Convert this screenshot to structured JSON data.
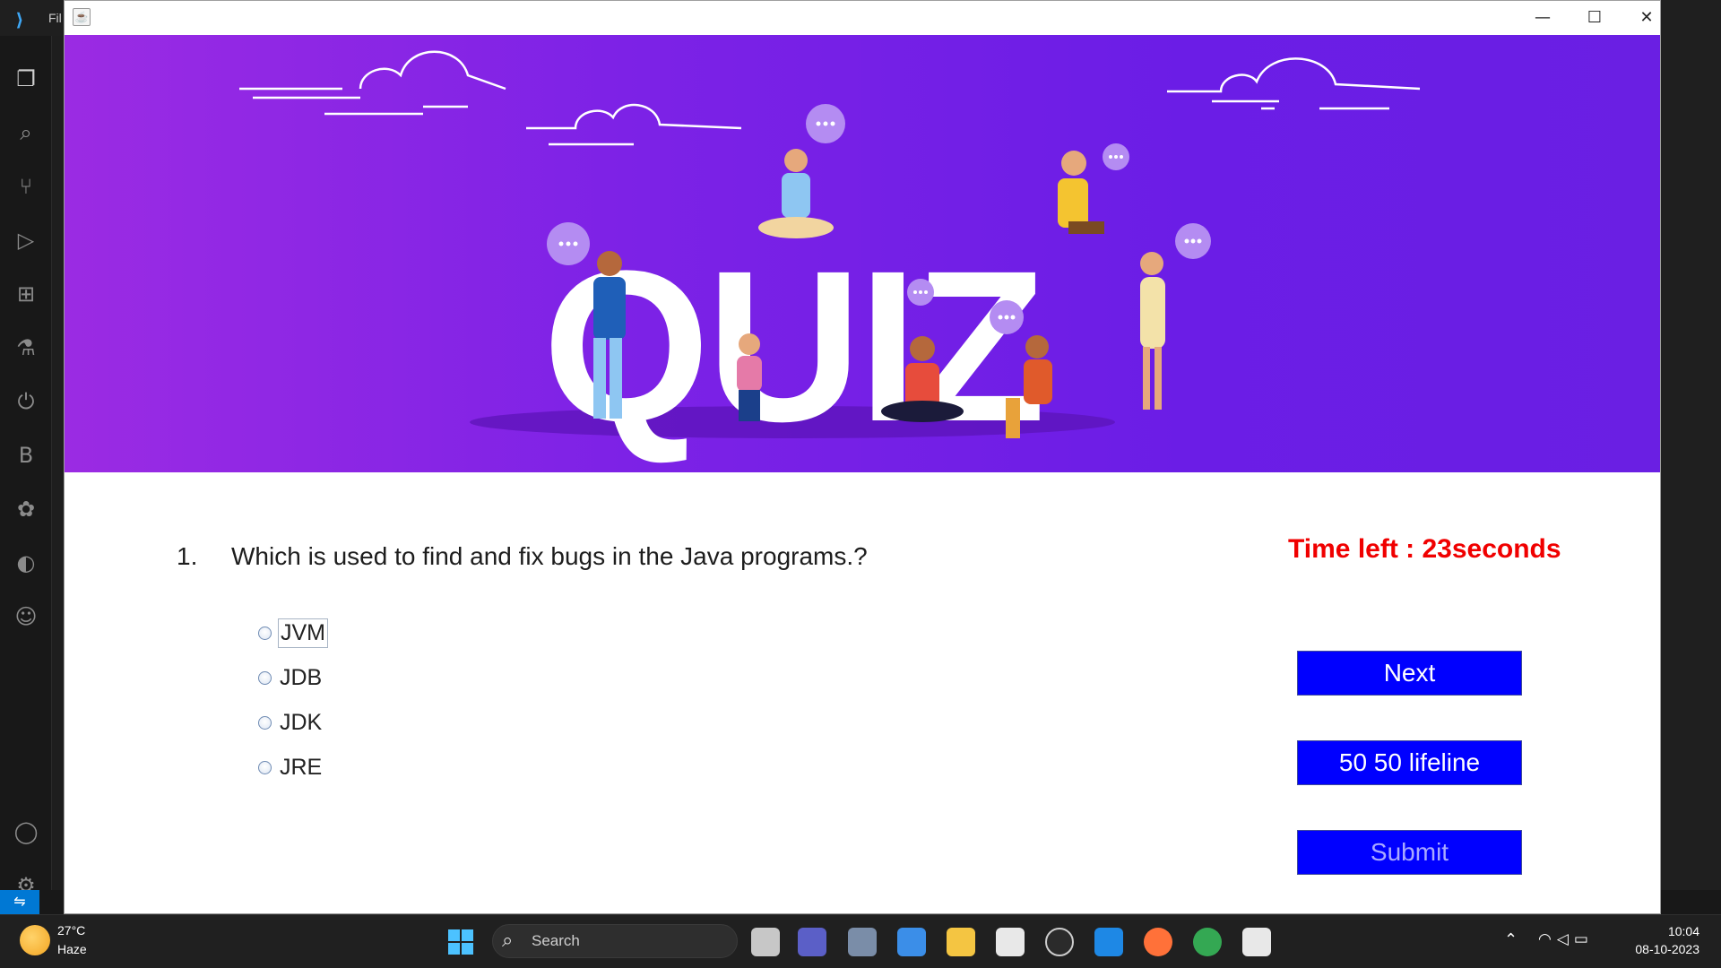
{
  "vscode": {
    "menu_file": "Fil",
    "activity_letter": "B"
  },
  "app": {
    "title": "",
    "window_controls": {
      "minimize": "—",
      "maximize": "☐",
      "close": "✕"
    }
  },
  "banner": {
    "word": "QUIZ"
  },
  "question": {
    "number": "1.",
    "text": "Which is used to find and fix bugs in the Java programs.?",
    "options": [
      {
        "label": "JVM",
        "selected": false
      },
      {
        "label": "JDB",
        "selected": false
      },
      {
        "label": "JDK",
        "selected": false
      },
      {
        "label": "JRE",
        "selected": false
      }
    ]
  },
  "timer": {
    "text": "Time left : 23seconds",
    "color": "#f00000"
  },
  "buttons": {
    "next": "Next",
    "lifeline": "50 50 lifeline",
    "submit": "Submit",
    "color": "#0000ff"
  },
  "taskbar": {
    "weather_temp": "27°C",
    "weather_desc": "Haze",
    "search_label": "Search",
    "time": "10:04",
    "date": "08-10-2023"
  }
}
